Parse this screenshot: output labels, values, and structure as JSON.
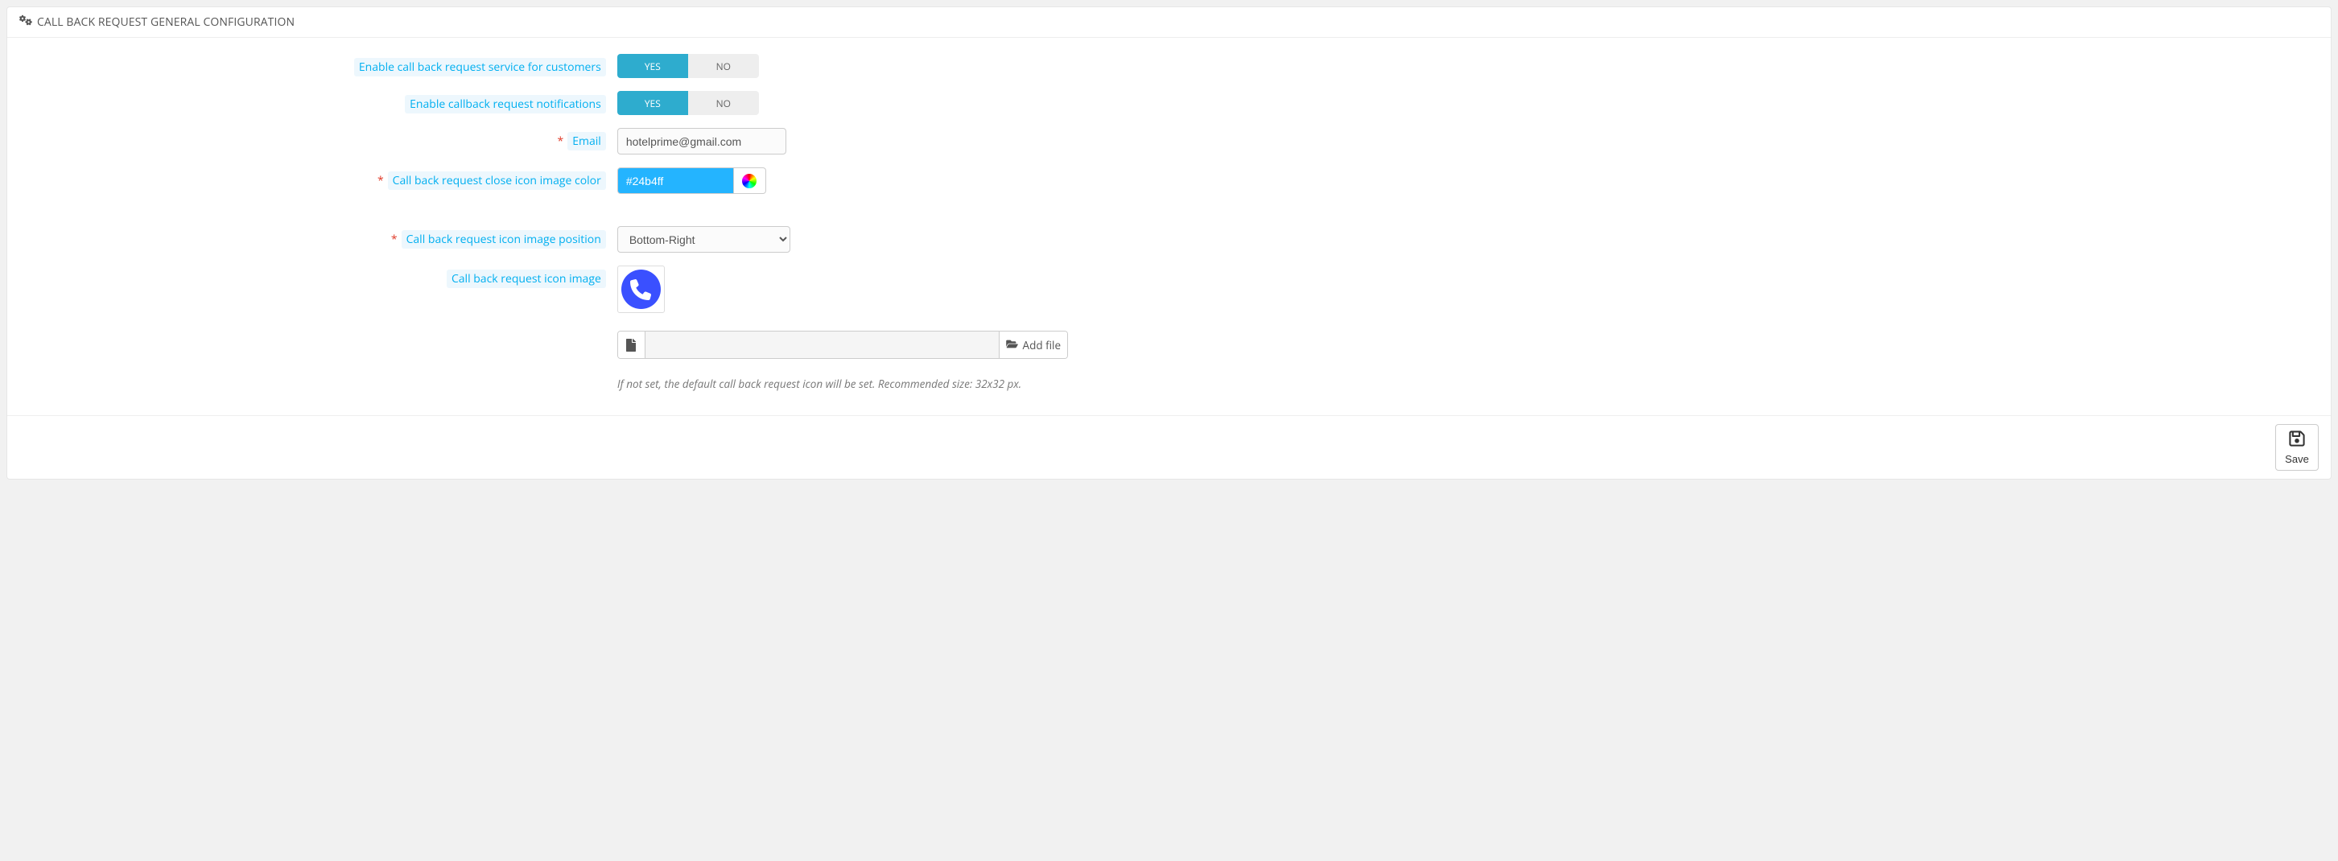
{
  "panel": {
    "title": "CALL BACK REQUEST GENERAL CONFIGURATION"
  },
  "toggle_values": {
    "yes": "YES",
    "no": "NO"
  },
  "fields": {
    "enable_service": {
      "label": "Enable call back request service for customers",
      "value": "yes"
    },
    "enable_notifications": {
      "label": "Enable callback request notifications",
      "value": "yes"
    },
    "email": {
      "label": "Email",
      "value": "hotelprime@gmail.com"
    },
    "close_icon_color": {
      "label": "Call back request close icon image color",
      "value": "#24b4ff"
    },
    "icon_position": {
      "label": "Call back request icon image position",
      "value": "Bottom-Right"
    },
    "icon_image": {
      "label": "Call back request icon image",
      "help": "If not set, the default call back request icon will be set. Recommended size: 32x32 px."
    }
  },
  "file_button_label": "Add file",
  "footer": {
    "save_label": "Save"
  }
}
